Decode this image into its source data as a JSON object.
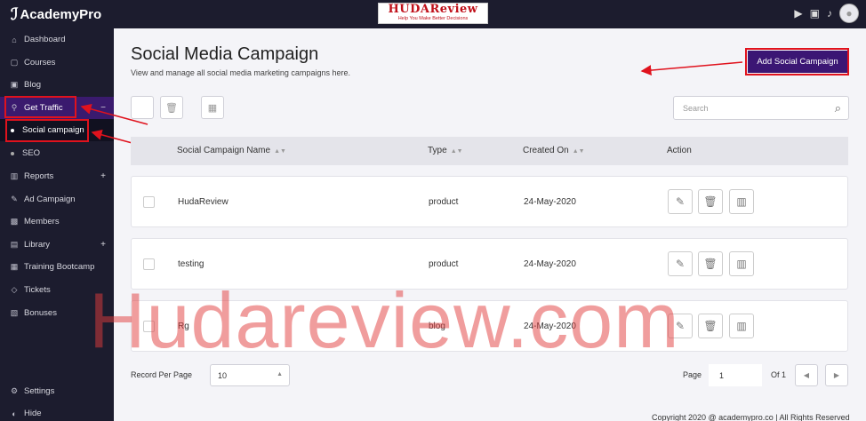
{
  "app": {
    "logo_text": "AcademyPro",
    "brand_title": "HUDAReview",
    "brand_tagline": "Help You Make Better Decisions"
  },
  "sidebar": {
    "items": [
      {
        "label": "Dashboard",
        "icon": "home-icon"
      },
      {
        "label": "Courses",
        "icon": "courses-icon"
      },
      {
        "label": "Blog",
        "icon": "blog-icon"
      },
      {
        "label": "Get Traffic",
        "icon": "traffic-icon",
        "toggle": "−"
      },
      {
        "label": "Social campaign"
      },
      {
        "label": "SEO"
      },
      {
        "label": "Reports",
        "icon": "reports-icon",
        "toggle": "+"
      },
      {
        "label": "Ad Campaign",
        "icon": "ad-icon"
      },
      {
        "label": "Members",
        "icon": "members-icon"
      },
      {
        "label": "Library",
        "icon": "library-icon",
        "toggle": "+"
      },
      {
        "label": "Training Bootcamp",
        "icon": "bootcamp-icon"
      },
      {
        "label": "Tickets",
        "icon": "ticket-icon"
      },
      {
        "label": "Bonuses",
        "icon": "bonus-icon"
      },
      {
        "label": "Settings",
        "icon": "gear-icon"
      },
      {
        "label": "Hide",
        "icon": "hide-icon"
      }
    ]
  },
  "page": {
    "title": "Social Media Campaign",
    "subtitle": "View and manage all social media marketing campaigns here.",
    "add_button": "Add Social Campaign",
    "search_placeholder": "Search"
  },
  "table": {
    "headers": [
      "Social Campaign Name",
      "Type",
      "Created On",
      "Action"
    ],
    "rows": [
      {
        "name": "HudaReview",
        "type": "product",
        "created": "24-May-2020"
      },
      {
        "name": "testing",
        "type": "product",
        "created": "24-May-2020"
      },
      {
        "name": "Rg",
        "type": "blog",
        "created": "24-May-2020"
      }
    ]
  },
  "pagination": {
    "records_label": "Record Per Page",
    "records_value": "10",
    "page_label": "Page",
    "page_value": "1",
    "of_label": "Of 1"
  },
  "footer": {
    "copyright": "Copyright 2020 @ academypro.co | All Rights Reserved"
  },
  "watermark": "Hudareview.com",
  "colors": {
    "sidebar": "#1c1c2e",
    "accent": "#3b1674",
    "highlight": "#e0121d"
  }
}
